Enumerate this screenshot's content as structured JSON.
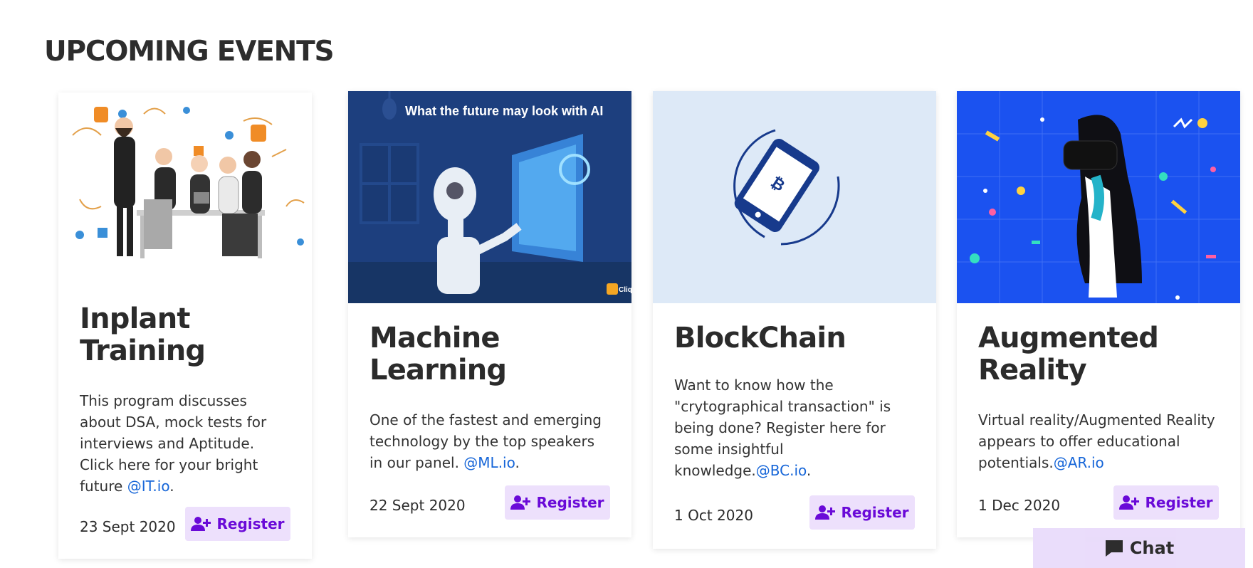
{
  "section": {
    "title": "UPCOMING EVENTS"
  },
  "events": [
    {
      "title_line1": "Inplant",
      "title_line2": "Training",
      "description": "This program discusses about DSA, mock tests for interviews and Aptitude. Click here for your bright future ",
      "link": "@IT.io",
      "suffix": ".",
      "date": "23 Sept 2020",
      "register": "Register",
      "image_icon": "team-meeting-illustration"
    },
    {
      "title_line1": "Machine",
      "title_line2": "Learning",
      "description": "One of the fastest and emerging technology by the top speakers in our panel. ",
      "link": "@ML.io",
      "suffix": ".",
      "date": "22 Sept 2020",
      "register": "Register",
      "image_caption": "What the future may look with AI",
      "image_badge": "Cliq",
      "image_icon": "robot-illustration"
    },
    {
      "title_line1": "BlockChain",
      "title_line2": "",
      "description": "Want to know how the \"crytographical transaction\" is being done? Register here for some insightful knowledge.",
      "link": "@BC.io",
      "suffix": ".",
      "date": "1 Oct 2020",
      "register": "Register",
      "image_icon": "bitcoin-phone-illustration"
    },
    {
      "title_line1": "Augmented",
      "title_line2": "Reality",
      "description": "Virtual reality/Augmented Reality appears to offer educational potentials.",
      "link": "@AR.io",
      "suffix": "",
      "date": "1 Dec 2020",
      "register": "Register",
      "image_icon": "vr-headset-illustration"
    }
  ],
  "chat": {
    "label": "Chat",
    "icon": "chat-bubble-icon"
  },
  "colors": {
    "accent": "#6a0ad8",
    "button_bg": "#ede0fc",
    "link": "#1565d8"
  }
}
